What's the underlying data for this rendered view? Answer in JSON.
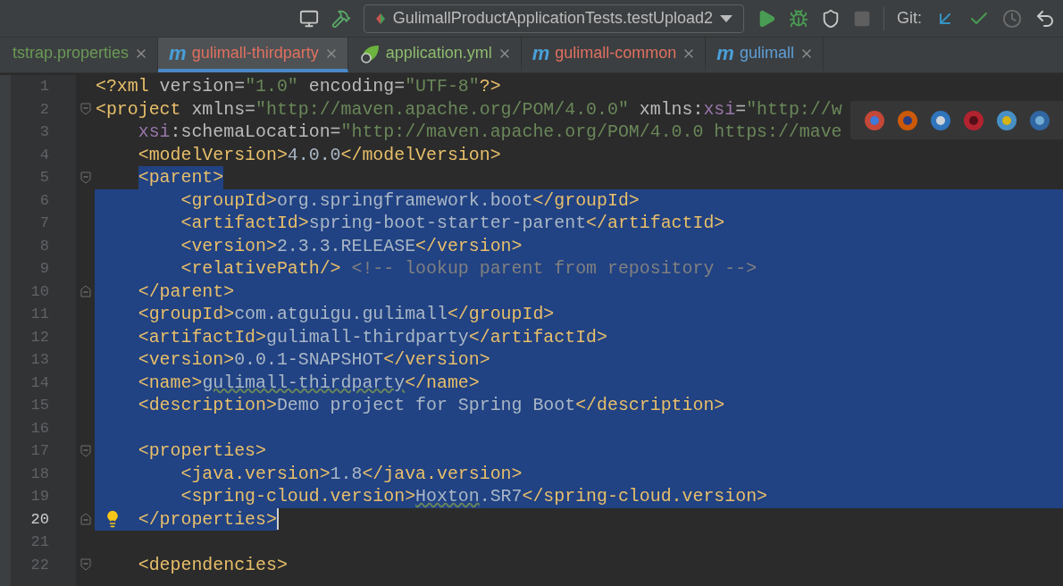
{
  "toolbar": {
    "run_config": "GulimallProductApplicationTests.testUpload2",
    "vcs_label": "Git:"
  },
  "tabs": [
    {
      "label": "tstrap.properties",
      "selected": false,
      "color": "#6a9955",
      "kind": "plain"
    },
    {
      "label": "gulimall-thirdparty",
      "selected": true,
      "color": "#e0705f",
      "kind": "maven",
      "letter": "m"
    },
    {
      "label": "application.yml",
      "selected": false,
      "color": "#8dbb6e",
      "kind": "spring"
    },
    {
      "label": "gulimall-common",
      "selected": false,
      "color": "#e0705f",
      "kind": "maven",
      "letter": "m"
    },
    {
      "label": "gulimall",
      "selected": false,
      "color": "#5e9fd8",
      "kind": "maven",
      "letter": "m"
    }
  ],
  "editor": {
    "lines": [
      {
        "number": "1",
        "selected": false,
        "tokens": [
          {
            "kind": "tag",
            "t": "<?xml"
          },
          {
            "kind": "attr",
            "t": " version="
          },
          {
            "kind": "str",
            "t": "\"1.0\""
          },
          {
            "kind": "attr",
            "t": " encoding="
          },
          {
            "kind": "str",
            "t": "\"UTF-8\""
          },
          {
            "kind": "tag",
            "t": "?>"
          }
        ]
      },
      {
        "number": "2",
        "selected": false,
        "fold": true,
        "tokens": [
          {
            "kind": "tag",
            "t": "<project"
          },
          {
            "kind": "attr",
            "t": " xmlns="
          },
          {
            "kind": "str",
            "t": "\"http://maven.apache.org/POM/4.0.0\""
          },
          {
            "kind": "attr",
            "t": " xmlns:"
          },
          {
            "kind": "ns",
            "t": "xsi"
          },
          {
            "kind": "attr",
            "t": "="
          },
          {
            "kind": "str",
            "t": "\"http://w"
          }
        ]
      },
      {
        "number": "3",
        "selected": false,
        "tokens": [
          {
            "kind": "ns",
            "t": "    xsi"
          },
          {
            "kind": "attr",
            "t": ":schemaLocation="
          },
          {
            "kind": "str",
            "t": "\"http://maven.apache.org/POM/4.0.0 https://mave"
          }
        ]
      },
      {
        "number": "4",
        "selected": false,
        "tokens": [
          {
            "kind": "tag",
            "t": "    <modelVersion>"
          },
          {
            "kind": "text",
            "t": "4.0.0"
          },
          {
            "kind": "tag",
            "t": "</modelVersion>"
          }
        ]
      },
      {
        "number": "5",
        "selected": true,
        "kind": "selection-start",
        "fold": true,
        "tokens": [
          {
            "kind": "tag",
            "t": "    <parent>"
          }
        ]
      },
      {
        "number": "6",
        "selected": true,
        "tokens": [
          {
            "kind": "tag",
            "t": "        <groupId>"
          },
          {
            "kind": "text",
            "t": "org.springframework.boot"
          },
          {
            "kind": "tag",
            "t": "</groupId>"
          }
        ]
      },
      {
        "number": "7",
        "selected": true,
        "tokens": [
          {
            "kind": "tag",
            "t": "        <artifactId>"
          },
          {
            "kind": "text",
            "t": "spring-boot-starter-parent"
          },
          {
            "kind": "tag",
            "t": "</artifactId>"
          }
        ]
      },
      {
        "number": "8",
        "selected": true,
        "tokens": [
          {
            "kind": "tag",
            "t": "        <version>"
          },
          {
            "kind": "text",
            "t": "2.3.3.RELEASE"
          },
          {
            "kind": "tag",
            "t": "</version>"
          }
        ]
      },
      {
        "number": "9",
        "selected": true,
        "tokens": [
          {
            "kind": "tag",
            "t": "        <relativePath/>"
          },
          {
            "kind": "comment",
            "t": " <!-- lookup parent from repository -->"
          }
        ]
      },
      {
        "number": "10",
        "selected": true,
        "fold": true,
        "tokens": [
          {
            "kind": "tag",
            "t": "    </parent>"
          }
        ]
      },
      {
        "number": "11",
        "selected": true,
        "tokens": [
          {
            "kind": "tag",
            "t": "    <groupId>"
          },
          {
            "kind": "text",
            "t": "com.atguigu.gulimall"
          },
          {
            "kind": "tag",
            "t": "</groupId>"
          }
        ]
      },
      {
        "number": "12",
        "selected": true,
        "tokens": [
          {
            "kind": "tag",
            "t": "    <artifactId>"
          },
          {
            "kind": "text",
            "t": "gulimall-thirdparty"
          },
          {
            "kind": "tag",
            "t": "</artifactId>"
          }
        ]
      },
      {
        "number": "13",
        "selected": true,
        "tokens": [
          {
            "kind": "tag",
            "t": "    <version>"
          },
          {
            "kind": "text",
            "t": "0.0.1-SNAPSHOT"
          },
          {
            "kind": "tag",
            "t": "</version>"
          }
        ]
      },
      {
        "number": "14",
        "selected": true,
        "tokens": [
          {
            "kind": "tag",
            "t": "    <name>"
          },
          {
            "kind": "typo",
            "t": "gulimall-thirdparty"
          },
          {
            "kind": "tag",
            "t": "</name>"
          }
        ]
      },
      {
        "number": "15",
        "selected": true,
        "tokens": [
          {
            "kind": "tag",
            "t": "    <description>"
          },
          {
            "kind": "text",
            "t": "Demo project for Spring Boot"
          },
          {
            "kind": "tag",
            "t": "</description>"
          }
        ]
      },
      {
        "number": "16",
        "selected": true
      },
      {
        "number": "17",
        "selected": true,
        "fold": true,
        "tokens": [
          {
            "kind": "tag",
            "t": "    <properties>"
          }
        ]
      },
      {
        "number": "18",
        "selected": true,
        "tokens": [
          {
            "kind": "tag",
            "t": "        <java.version>"
          },
          {
            "kind": "text",
            "t": "1.8"
          },
          {
            "kind": "tag",
            "t": "</java.version>"
          }
        ]
      },
      {
        "number": "19",
        "selected": true,
        "tokens": [
          {
            "kind": "tag",
            "t": "        <spring-cloud.version>"
          },
          {
            "kind": "typo",
            "t": "Hoxton"
          },
          {
            "kind": "text",
            "t": ".SR7"
          },
          {
            "kind": "tag",
            "t": "</spring-cloud.version>"
          }
        ]
      },
      {
        "number": "20",
        "selected": true,
        "fold": true,
        "bulb": true,
        "caret": true,
        "tokens": [
          {
            "kind": "tag",
            "t": "    </properties>"
          }
        ]
      },
      {
        "number": "21",
        "selected": false
      },
      {
        "number": "22",
        "selected": false,
        "fold": true,
        "tokens": [
          {
            "kind": "tag",
            "t": "    <dependencies>"
          }
        ]
      }
    ]
  }
}
